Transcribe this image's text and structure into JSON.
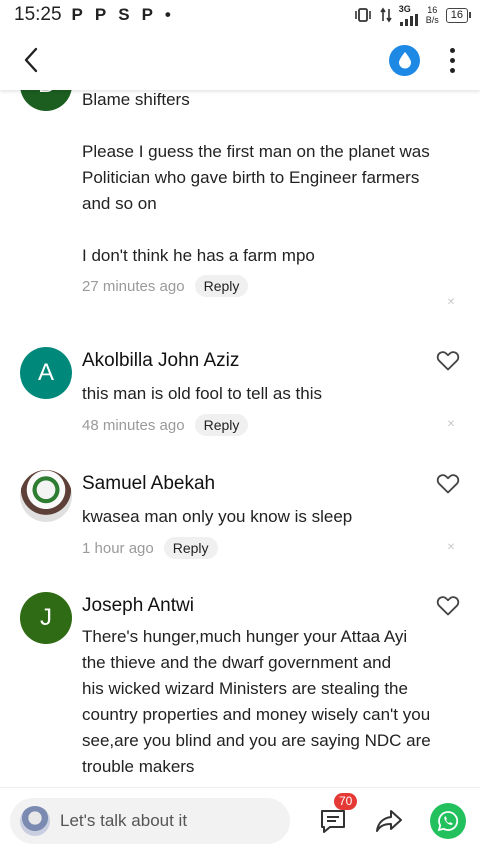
{
  "status_bar": {
    "time": "15:25",
    "left_icons": [
      "P",
      "P",
      "S",
      "P",
      "•"
    ],
    "network": "3G",
    "speed_top": "16",
    "speed_bottom": "B/s",
    "battery": "16"
  },
  "header": {
    "back_icon": "chevron-left-icon",
    "drop_icon": "water-drop-icon",
    "more_icon": "more-vertical-icon"
  },
  "comments": [
    {
      "initial": "B",
      "avatar_color": "#1b5e20",
      "text_lines": [
        "Blame shifters",
        "",
        "Please I guess the first man on the planet was",
        "Politician who gave birth to Engineer farmers",
        "and so on",
        "",
        "I don't think he has a farm mpo"
      ],
      "time": "27 minutes ago",
      "reply": "Reply"
    },
    {
      "initial": "A",
      "avatar_color": "#00897b",
      "name": "Akolbilla John Aziz",
      "text": "this man is old fool to tell as this",
      "time": "48 minutes ago",
      "reply": "Reply"
    },
    {
      "name": "Samuel Abekah",
      "text": "kwasea man only you know is sleep",
      "time": "1 hour ago",
      "reply": "Reply"
    },
    {
      "initial": "J",
      "avatar_color": "#2e6b14",
      "name": "Joseph Antwi",
      "text_lines": [
        "There's hunger,much hunger your Attaa Ayi",
        "the thieve and the dwarf government and",
        "his wicked wizard Ministers are stealing the",
        "country properties and money wisely can't you",
        "see,are you blind and you are saying NDC are",
        "trouble makers"
      ]
    }
  ],
  "bottom_bar": {
    "placeholder": "Let's talk about it",
    "comment_count": "70",
    "whatsapp_color": "#22c15e"
  }
}
